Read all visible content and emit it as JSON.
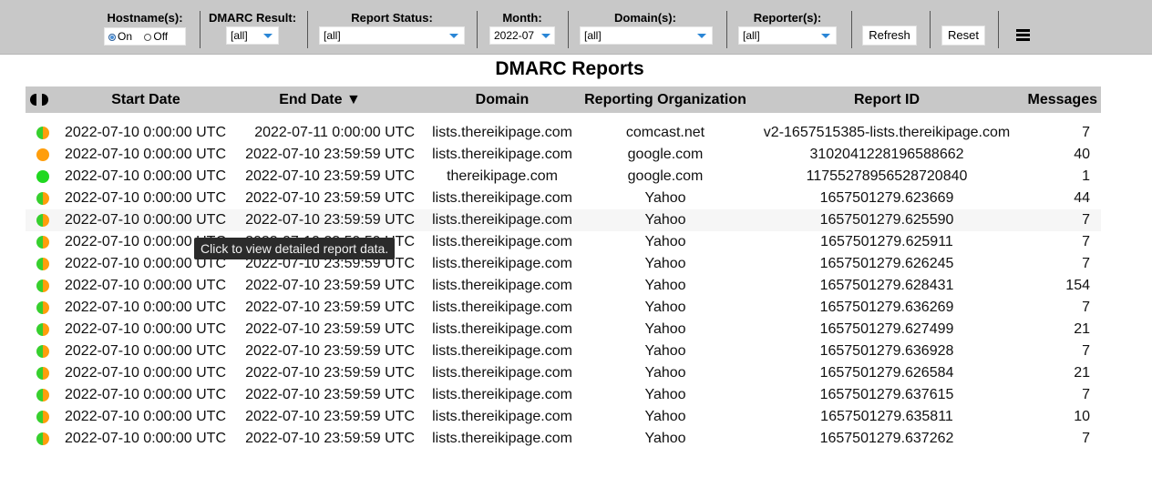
{
  "toolbar": {
    "hostname": {
      "label": "Hostname(s):",
      "on": "On",
      "off": "Off",
      "selected": "on"
    },
    "dmarc": {
      "label": "DMARC Result:",
      "value": "[all]"
    },
    "status": {
      "label": "Report Status:",
      "value": "[all]"
    },
    "month": {
      "label": "Month:",
      "value": "2022-07"
    },
    "domains": {
      "label": "Domain(s):",
      "value": "[all]"
    },
    "reporters": {
      "label": "Reporter(s):",
      "value": "[all]"
    },
    "refresh_label": "Refresh",
    "reset_label": "Reset",
    "menu_icon": "hamburger-menu-icon"
  },
  "title": "DMARC Reports",
  "table": {
    "headers": {
      "start": "Start Date",
      "end": "End Date ▼",
      "domain": "Domain",
      "org": "Reporting Organization",
      "id": "Report ID",
      "messages": "Messages"
    },
    "rows": [
      {
        "status": "mixed",
        "start": "2022-07-10 0:00:00 UTC",
        "end": "2022-07-11 0:00:00 UTC",
        "domain": "lists.thereikipage.com",
        "org": "comcast.net",
        "id": "v2-1657515385-lists.thereikipage.com",
        "messages": "7"
      },
      {
        "status": "orange",
        "start": "2022-07-10 0:00:00 UTC",
        "end": "2022-07-10 23:59:59 UTC",
        "domain": "lists.thereikipage.com",
        "org": "google.com",
        "id": "3102041228196588662",
        "messages": "40"
      },
      {
        "status": "green",
        "start": "2022-07-10 0:00:00 UTC",
        "end": "2022-07-10 23:59:59 UTC",
        "domain": "thereikipage.com",
        "org": "google.com",
        "id": "11755278956528720840",
        "messages": "1"
      },
      {
        "status": "mixed",
        "start": "2022-07-10 0:00:00 UTC",
        "end": "2022-07-10 23:59:59 UTC",
        "domain": "lists.thereikipage.com",
        "org": "Yahoo",
        "id": "1657501279.623669",
        "messages": "44"
      },
      {
        "status": "mixed",
        "start": "2022-07-10 0:00:00 UTC",
        "end": "2022-07-10 23:59:59 UTC",
        "domain": "lists.thereikipage.com",
        "org": "Yahoo",
        "id": "1657501279.625590",
        "messages": "7"
      },
      {
        "status": "mixed",
        "start": "2022-07-10 0:00:00 UTC",
        "end": "2022-07-10 23:59:59 UTC",
        "domain": "lists.thereikipage.com",
        "org": "Yahoo",
        "id": "1657501279.625911",
        "messages": "7"
      },
      {
        "status": "mixed",
        "start": "2022-07-10 0:00:00 UTC",
        "end": "2022-07-10 23:59:59 UTC",
        "domain": "lists.thereikipage.com",
        "org": "Yahoo",
        "id": "1657501279.626245",
        "messages": "7"
      },
      {
        "status": "mixed",
        "start": "2022-07-10 0:00:00 UTC",
        "end": "2022-07-10 23:59:59 UTC",
        "domain": "lists.thereikipage.com",
        "org": "Yahoo",
        "id": "1657501279.628431",
        "messages": "154"
      },
      {
        "status": "mixed",
        "start": "2022-07-10 0:00:00 UTC",
        "end": "2022-07-10 23:59:59 UTC",
        "domain": "lists.thereikipage.com",
        "org": "Yahoo",
        "id": "1657501279.636269",
        "messages": "7"
      },
      {
        "status": "mixed",
        "start": "2022-07-10 0:00:00 UTC",
        "end": "2022-07-10 23:59:59 UTC",
        "domain": "lists.thereikipage.com",
        "org": "Yahoo",
        "id": "1657501279.627499",
        "messages": "21"
      },
      {
        "status": "mixed",
        "start": "2022-07-10 0:00:00 UTC",
        "end": "2022-07-10 23:59:59 UTC",
        "domain": "lists.thereikipage.com",
        "org": "Yahoo",
        "id": "1657501279.636928",
        "messages": "7"
      },
      {
        "status": "mixed",
        "start": "2022-07-10 0:00:00 UTC",
        "end": "2022-07-10 23:59:59 UTC",
        "domain": "lists.thereikipage.com",
        "org": "Yahoo",
        "id": "1657501279.626584",
        "messages": "21"
      },
      {
        "status": "mixed",
        "start": "2022-07-10 0:00:00 UTC",
        "end": "2022-07-10 23:59:59 UTC",
        "domain": "lists.thereikipage.com",
        "org": "Yahoo",
        "id": "1657501279.637615",
        "messages": "7"
      },
      {
        "status": "mixed",
        "start": "2022-07-10 0:00:00 UTC",
        "end": "2022-07-10 23:59:59 UTC",
        "domain": "lists.thereikipage.com",
        "org": "Yahoo",
        "id": "1657501279.635811",
        "messages": "10"
      },
      {
        "status": "mixed",
        "start": "2022-07-10 0:00:00 UTC",
        "end": "2022-07-10 23:59:59 UTC",
        "domain": "lists.thereikipage.com",
        "org": "Yahoo",
        "id": "1657501279.637262",
        "messages": "7"
      },
      {
        "status": "mixed",
        "start": "",
        "end": "",
        "domain": "",
        "org": "",
        "id": "",
        "messages": ""
      }
    ],
    "highlighted_row": 4
  },
  "tooltip": "Click to view detailed report data.",
  "colors": {
    "pass": "#20d820",
    "fail": "#ff9e0c",
    "toolbar_bg": "#c8c8c8",
    "accent": "#2a86d6"
  }
}
